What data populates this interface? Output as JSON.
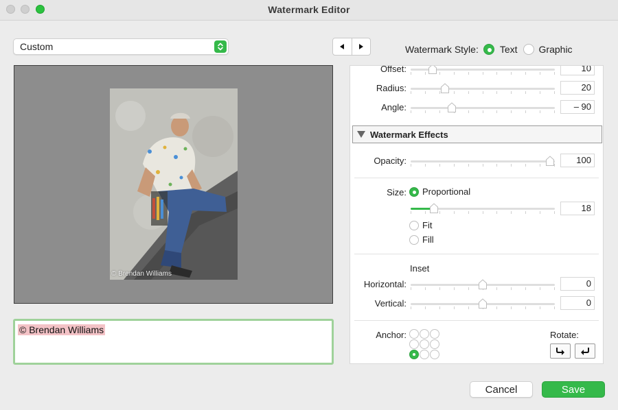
{
  "window": {
    "title": "Watermark Editor"
  },
  "preset": {
    "value": "Custom"
  },
  "nav": {
    "prev_icon": "triangle-left-icon",
    "next_icon": "triangle-right-icon"
  },
  "style": {
    "label": "Watermark Style:",
    "text_label": "Text",
    "graphic_label": "Graphic",
    "selected": "Text"
  },
  "preview": {
    "watermark_text": "© Brendan Williams"
  },
  "editor": {
    "text": "© Brendan Williams"
  },
  "shadow": {
    "offset": {
      "label": "Offset:",
      "value": "10",
      "fraction": 0.13
    },
    "radius": {
      "label": "Radius:",
      "value": "20",
      "fraction": 0.22
    },
    "angle": {
      "label": "Angle:",
      "value": "– 90",
      "fraction": 0.27
    }
  },
  "effects": {
    "header": "Watermark Effects",
    "opacity": {
      "label": "Opacity:",
      "value": "100",
      "fraction": 1.0
    },
    "size": {
      "label": "Size:",
      "proportional_label": "Proportional",
      "fit_label": "Fit",
      "fill_label": "Fill",
      "selected": "Proportional",
      "value": "18",
      "fraction": 0.14
    },
    "inset": {
      "label": "Inset",
      "horizontal": {
        "label": "Horizontal:",
        "value": "0",
        "fraction": 0.5
      },
      "vertical": {
        "label": "Vertical:",
        "value": "0",
        "fraction": 0.5
      }
    },
    "anchor": {
      "label": "Anchor:",
      "selected": "bottom-left"
    },
    "rotate": {
      "label": "Rotate:",
      "cw_icon": "rotate-clockwise-icon",
      "ccw_icon": "rotate-counterclockwise-icon"
    }
  },
  "footer": {
    "cancel_label": "Cancel",
    "save_label": "Save"
  },
  "colors": {
    "accent": "#35b94a",
    "selection": "#f3c2c6",
    "focus_ring": "#9fd29a"
  }
}
